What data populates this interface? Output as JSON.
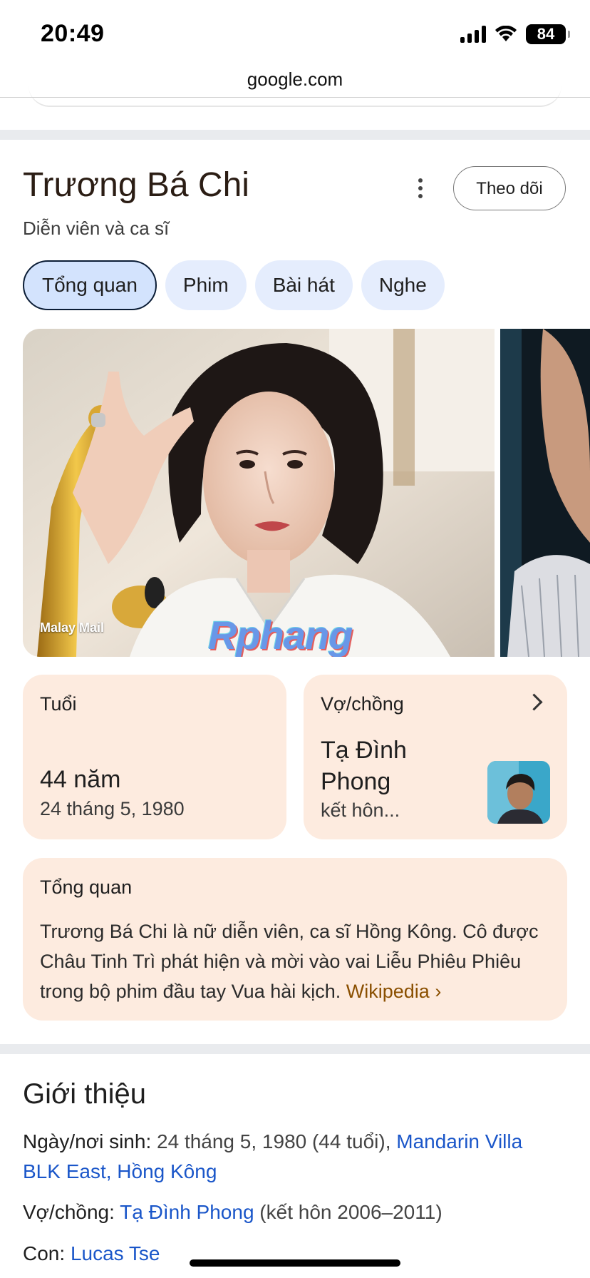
{
  "status_bar": {
    "time": "20:49",
    "battery": "84"
  },
  "browser": {
    "url": "google.com"
  },
  "entity": {
    "name": "Trương Bá Chi",
    "description": "Diễn viên và ca sĩ",
    "follow_label": "Theo dõi"
  },
  "tabs": [
    {
      "label": "Tổng quan",
      "active": true
    },
    {
      "label": "Phim",
      "active": false
    },
    {
      "label": "Bài hát",
      "active": false
    },
    {
      "label": "Nghe",
      "active": false
    }
  ],
  "images": {
    "credit": "Malay Mail",
    "watermark": "Rphang"
  },
  "age_card": {
    "label": "Tuổi",
    "value": "44 năm",
    "date": "24 tháng 5, 1980"
  },
  "spouse_card": {
    "label": "Vợ/chồng",
    "name": "Tạ Đình Phong",
    "status": "kết hôn..."
  },
  "overview": {
    "label": "Tổng quan",
    "text": "Trương Bá Chi là nữ diễn viên, ca sĩ Hồng Kông. Cô được Châu Tinh Trì phát hiện và mời vào vai Liễu Phiêu Phiêu trong bộ phim đầu tay Vua hài kịch.",
    "source_link": "Wikipedia ›"
  },
  "about": {
    "title": "Giới thiệu",
    "birth": {
      "key": "Ngày/nơi sinh:",
      "text": "24 tháng 5, 1980 (44 tuổi),",
      "link": "Mandarin Villa BLK East, Hồng Kông"
    },
    "spouse": {
      "key": "Vợ/chồng:",
      "link": "Tạ Đình Phong",
      "text": "(kết hôn 2006–2011)"
    },
    "children": {
      "key": "Con:",
      "link": "Lucas Tse"
    }
  }
}
